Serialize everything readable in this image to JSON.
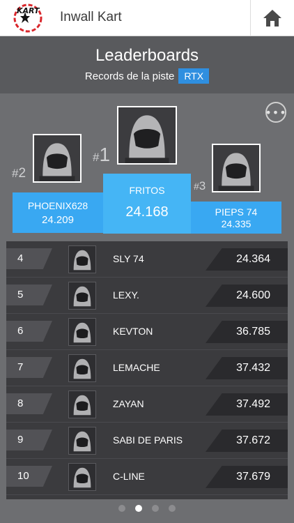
{
  "app": {
    "title": "Inwall Kart",
    "logo_text": "KART"
  },
  "header": {
    "title": "Leaderboards",
    "subtitle": "Records de la piste",
    "track_badge": "RTX"
  },
  "podium": [
    {
      "rank": "1",
      "hash": "#",
      "name": "FRITOS",
      "time": "24.168"
    },
    {
      "rank": "2",
      "hash": "#",
      "name": "PHOENIX628",
      "time": "24.209"
    },
    {
      "rank": "3",
      "hash": "#",
      "name": "PIEPS 74",
      "time": "24.335"
    }
  ],
  "rows": [
    {
      "rank": "4",
      "name": "SLY 74",
      "time": "24.364"
    },
    {
      "rank": "5",
      "name": "LEXY.",
      "time": "24.600"
    },
    {
      "rank": "6",
      "name": "KEVTON",
      "time": "36.785"
    },
    {
      "rank": "7",
      "name": "LEMACHE",
      "time": "37.432"
    },
    {
      "rank": "8",
      "name": "ZAYAN",
      "time": "37.492"
    },
    {
      "rank": "9",
      "name": "SABI DE PARIS",
      "time": "37.672"
    },
    {
      "rank": "10",
      "name": "C-LINE",
      "time": "37.679"
    }
  ],
  "pagination": {
    "count": 4,
    "active_index": 1
  },
  "colors": {
    "accent": "#2f8fe0",
    "podium_blue": "#39a8f2"
  }
}
